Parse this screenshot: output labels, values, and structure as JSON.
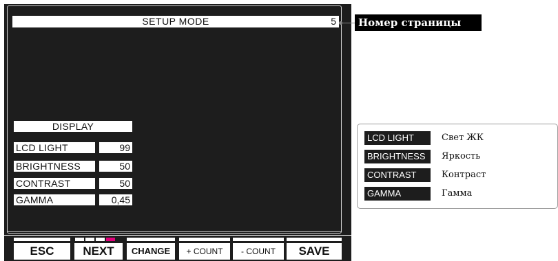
{
  "screen": {
    "title": "SETUP MODE",
    "page_number": "5",
    "section": "DISPLAY",
    "rows": [
      {
        "label": "LCD LIGHT",
        "value": "99"
      },
      {
        "label": "BRIGHTNESS",
        "value": "50"
      },
      {
        "label": "CONTRAST",
        "value": "50"
      },
      {
        "label": "GAMMA",
        "value": "0,45"
      }
    ]
  },
  "softkeys": [
    "ESC",
    "NEXT",
    "CHANGE",
    "+ COUNT",
    "- COUNT",
    "SAVE"
  ],
  "pager": {
    "total": 4,
    "active_index": 3
  },
  "callout": {
    "page_number_label": "Номер страницы"
  },
  "legend": [
    {
      "term": "LCD LIGHT",
      "desc": "Свет ЖК"
    },
    {
      "term": "BRIGHTNESS",
      "desc": "Яркость"
    },
    {
      "term": "CONTRAST",
      "desc": "Контраст"
    },
    {
      "term": "GAMMA",
      "desc": "Гамма"
    }
  ],
  "colors": {
    "screen_bg": "#1d1d1d",
    "pager_active": "#e0007a"
  }
}
